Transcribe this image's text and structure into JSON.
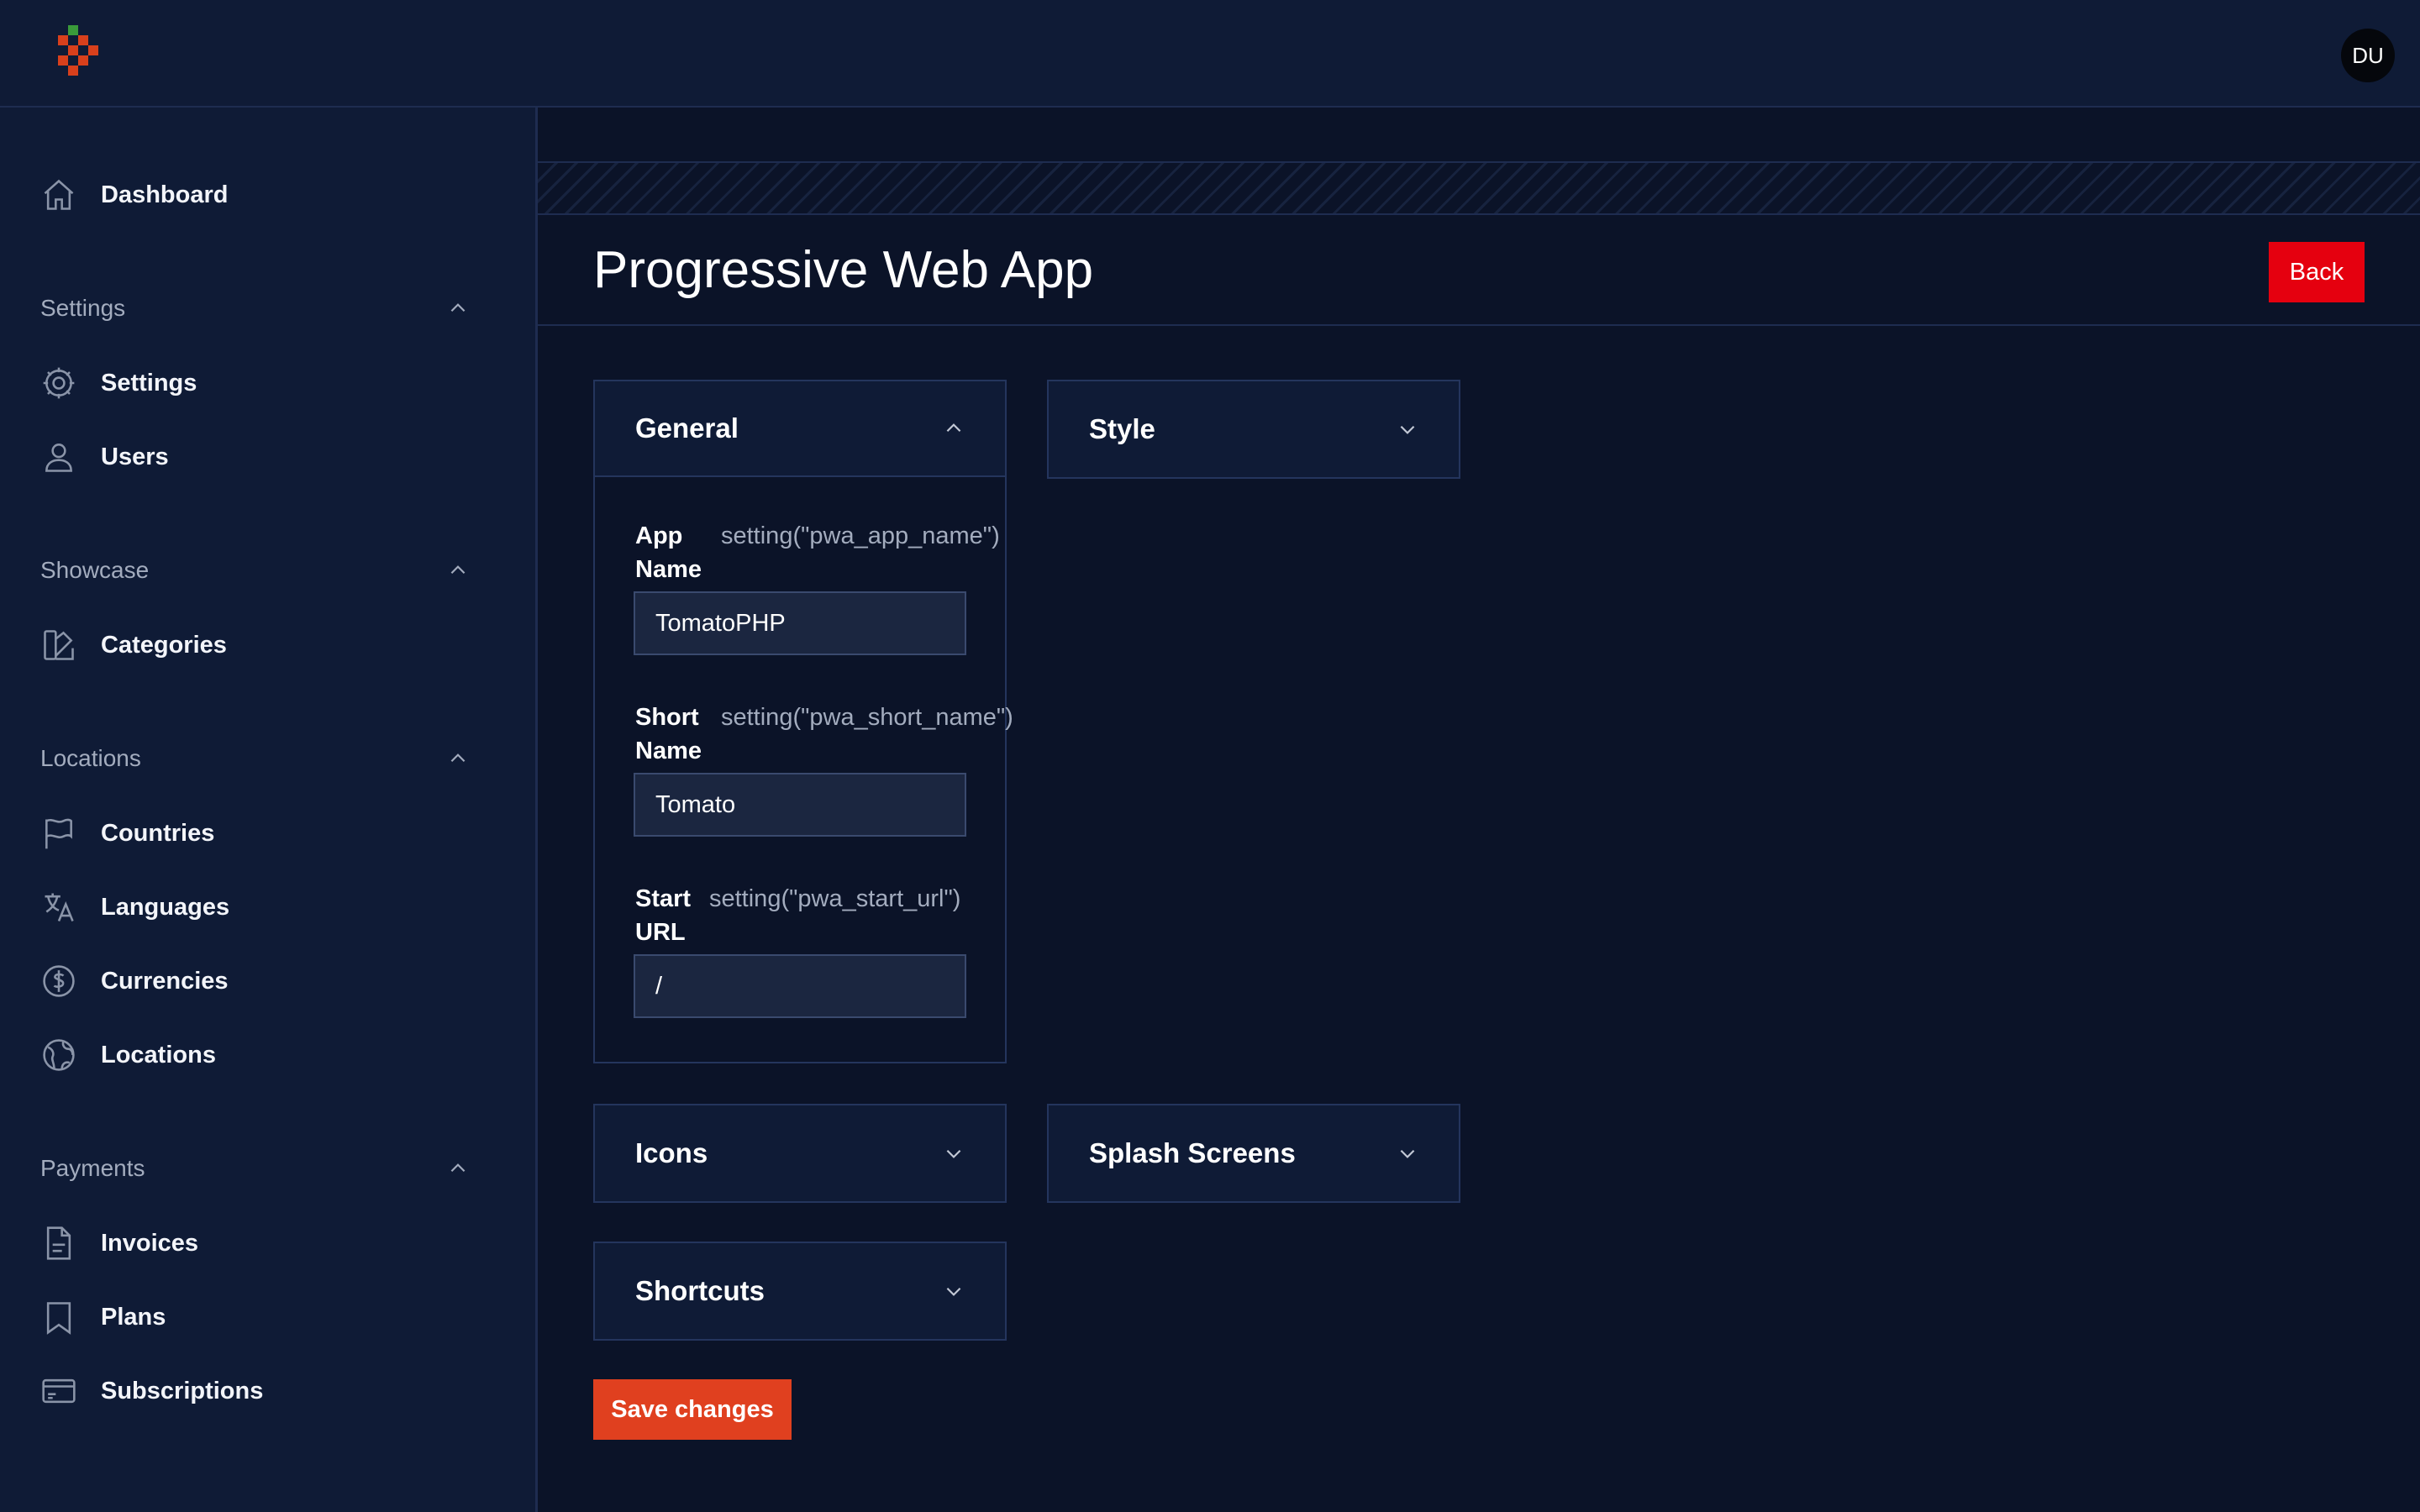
{
  "header": {
    "avatar_initials": "DU"
  },
  "sidebar": {
    "dashboard": "Dashboard",
    "groups": [
      {
        "label": "Settings",
        "items": [
          "Settings",
          "Users"
        ]
      },
      {
        "label": "Showcase",
        "items": [
          "Categories"
        ]
      },
      {
        "label": "Locations",
        "items": [
          "Countries",
          "Languages",
          "Currencies",
          "Locations"
        ]
      },
      {
        "label": "Payments",
        "items": [
          "Invoices",
          "Plans",
          "Subscriptions"
        ]
      }
    ]
  },
  "page": {
    "title": "Progressive Web App",
    "back_label": "Back",
    "save_label": "Save changes"
  },
  "sections": {
    "general": {
      "title": "General",
      "fields": [
        {
          "label": "App Name",
          "hint": "setting(\"pwa_app_name\")",
          "value": "TomatoPHP"
        },
        {
          "label": "Short Name",
          "hint": "setting(\"pwa_short_name\")",
          "value": "Tomato"
        },
        {
          "label": "Start URL",
          "hint": "setting(\"pwa_start_url\")",
          "value": "/"
        }
      ]
    },
    "style": {
      "title": "Style"
    },
    "icons": {
      "title": "Icons"
    },
    "splash": {
      "title": "Splash Screens"
    },
    "shortcuts": {
      "title": "Shortcuts"
    }
  },
  "colors": {
    "background": "#0b1328",
    "panel": "#0f1b36",
    "back_button": "#e5000f",
    "save_button": "#e0401f"
  }
}
